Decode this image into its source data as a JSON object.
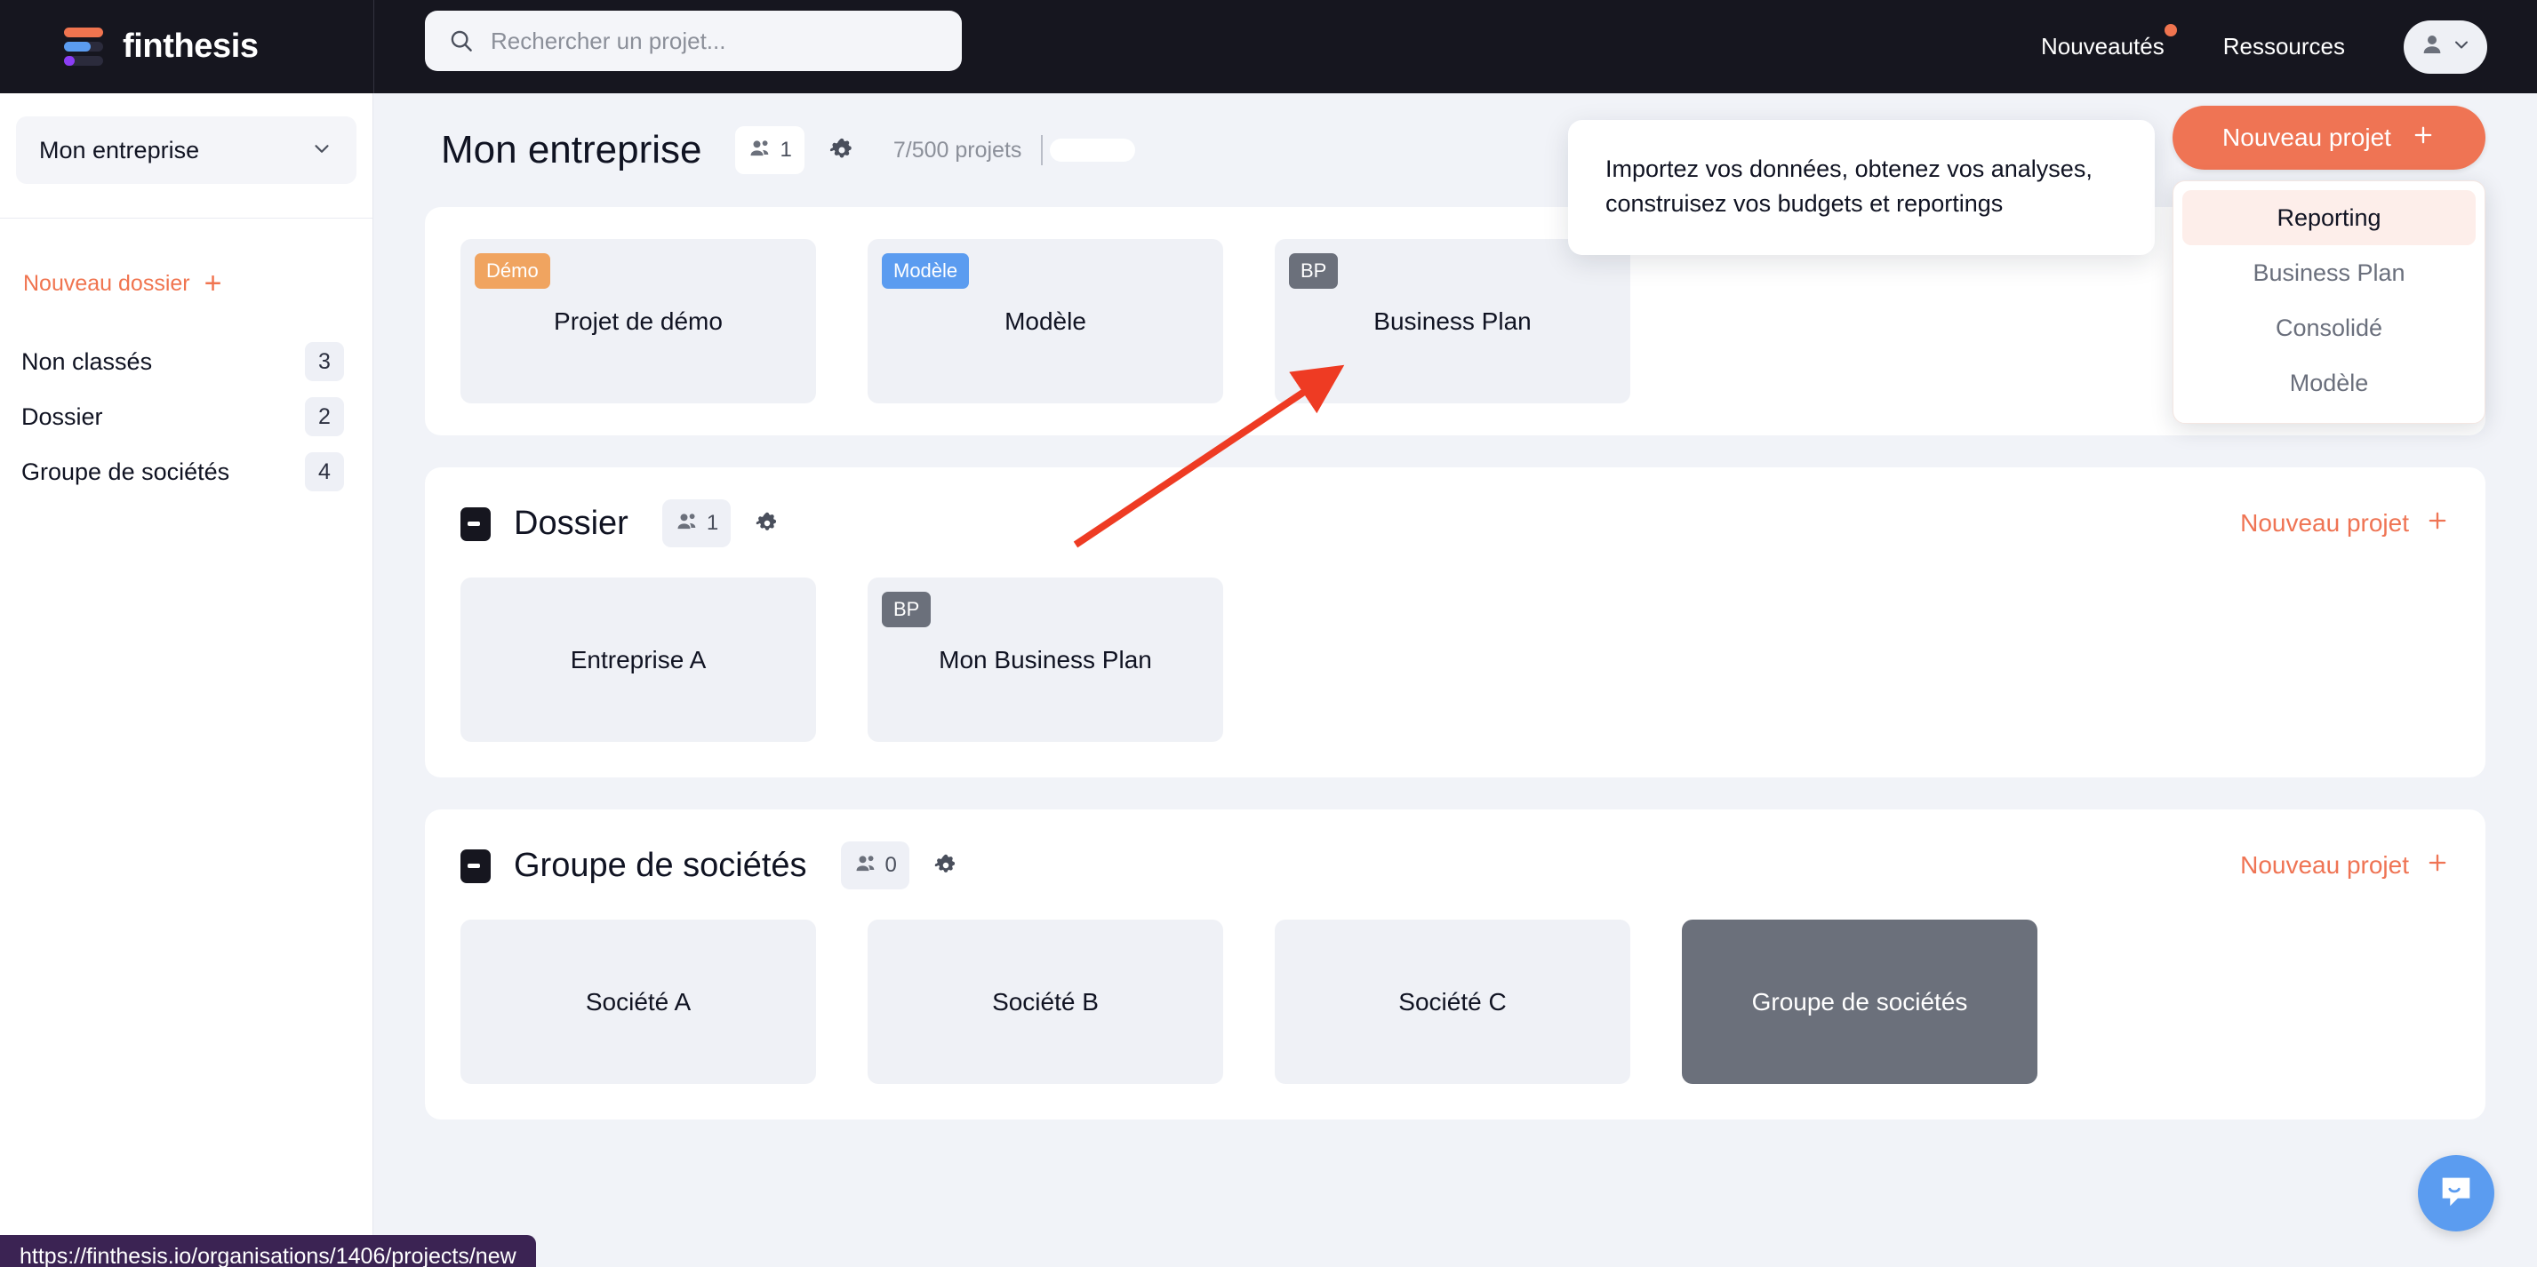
{
  "topbar": {
    "logo_text": "finthesis",
    "logo_icon": "finthesis-bars-logo",
    "search": {
      "placeholder": "Rechercher un projet...",
      "value": "",
      "icon": "search-icon"
    },
    "nav": [
      {
        "label": "Nouveautés",
        "has_dot": true
      },
      {
        "label": "Ressources",
        "has_dot": false
      }
    ],
    "avatar": {
      "icon": "user-icon",
      "chevron": "chevron-down-icon"
    }
  },
  "sidebar": {
    "org_selector": {
      "label": "Mon entreprise",
      "chevron": "chevron-down-icon"
    },
    "new_folder": {
      "label": "Nouveau dossier",
      "icon": "plus-icon"
    },
    "folders": [
      {
        "label": "Non classés",
        "count": "3"
      },
      {
        "label": "Dossier",
        "count": "2"
      },
      {
        "label": "Groupe de sociétés",
        "count": "4"
      }
    ]
  },
  "main": {
    "page_title": "Mon entreprise",
    "members_count": "1",
    "members_icon": "people-icon",
    "gear_icon": "gear-icon",
    "quota_text": "7/500 projets",
    "new_project_button": {
      "label": "Nouveau projet",
      "icon": "plus-icon"
    },
    "new_project_menu": [
      {
        "label": "Reporting",
        "active": true
      },
      {
        "label": "Business Plan",
        "active": false
      },
      {
        "label": "Consolidé",
        "active": false
      },
      {
        "label": "Modèle",
        "active": false
      }
    ],
    "tooltip_text": "Importez vos données, obtenez vos analyses, construisez vos budgets et reportings",
    "unclassified_projects": [
      {
        "title": "Projet de démo",
        "badge": "Démo",
        "badge_kind": "demo"
      },
      {
        "title": "Modèle",
        "badge": "Modèle",
        "badge_kind": "modele"
      },
      {
        "title": "Business Plan",
        "badge": "BP",
        "badge_kind": "bp"
      }
    ],
    "folders": [
      {
        "title": "Dossier",
        "icon": "folder-icon",
        "members_count": "1",
        "new_project_label": "Nouveau projet",
        "projects": [
          {
            "title": "Entreprise A",
            "badge": "",
            "badge_kind": "",
            "dark": false
          },
          {
            "title": "Mon Business Plan",
            "badge": "BP",
            "badge_kind": "bp",
            "dark": false
          }
        ]
      },
      {
        "title": "Groupe de sociétés",
        "icon": "folder-icon",
        "members_count": "0",
        "new_project_label": "Nouveau projet",
        "projects": [
          {
            "title": "Société A",
            "badge": "",
            "badge_kind": "",
            "dark": false
          },
          {
            "title": "Société B",
            "badge": "",
            "badge_kind": "",
            "dark": false
          },
          {
            "title": "Société C",
            "badge": "",
            "badge_kind": "",
            "dark": false
          },
          {
            "title": "Groupe de sociétés",
            "badge": "",
            "badge_kind": "",
            "dark": true
          }
        ]
      }
    ]
  },
  "chat_widget": {
    "icon": "chat-bubble-icon"
  },
  "status_url": "https://finthesis.io/organisations/1406/projects/new",
  "colors": {
    "accent": "#ef7454",
    "topbar_bg": "#16161f",
    "page_bg": "#f1f3f8",
    "card_bg": "#eff1f6",
    "card_dark_bg": "#6b707b",
    "badge_demo": "#f0a460",
    "badge_modele": "#5b9cf0",
    "badge_bp": "#6b707b",
    "menu_active_bg": "#fdeeea",
    "annotation_arrow": "#ee3b23",
    "status_bar_bg": "#3b2353",
    "chat_widget": "#5b9cf0"
  }
}
